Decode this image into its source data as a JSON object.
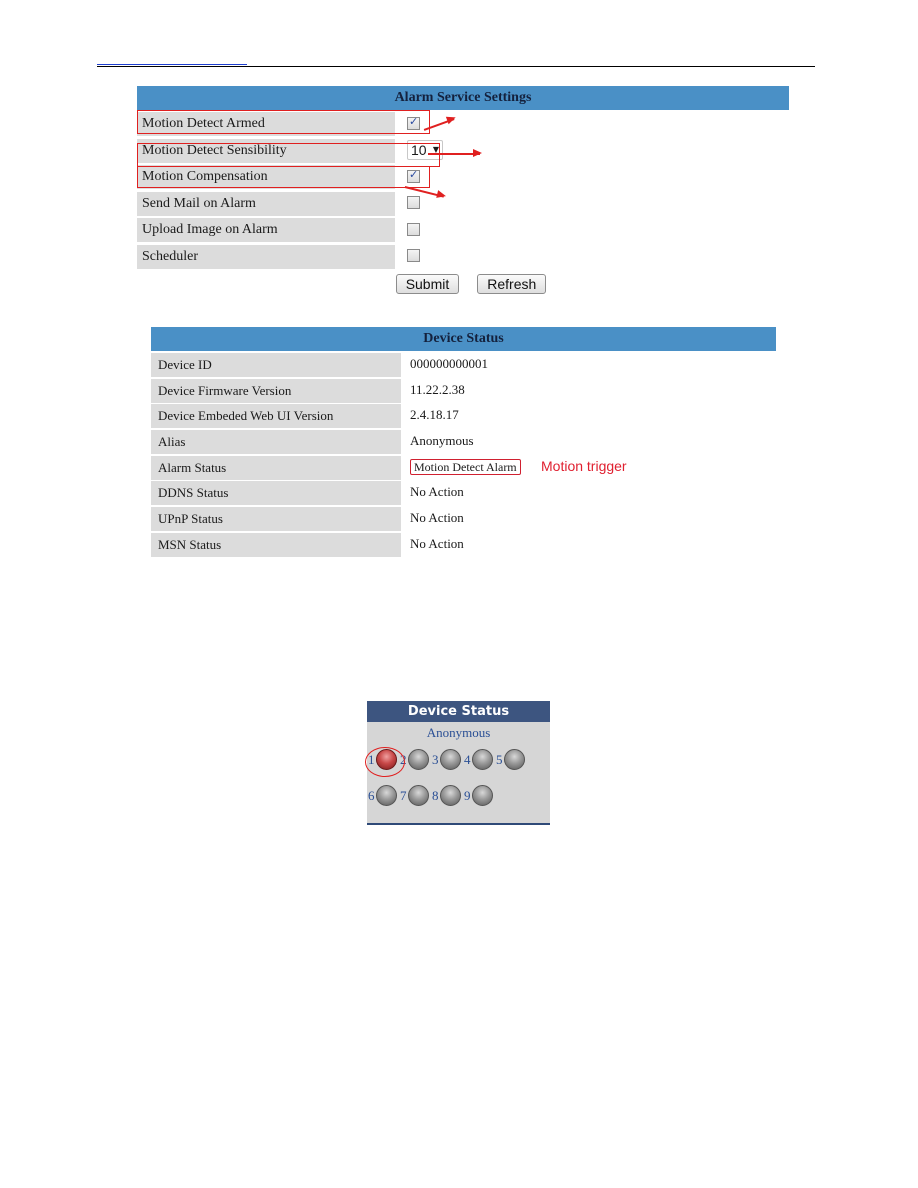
{
  "alarm_settings": {
    "title": "Alarm Service Settings",
    "rows": [
      {
        "label": "Motion Detect Armed",
        "type": "checkbox",
        "checked": true
      },
      {
        "label": "Motion Detect Sensibility",
        "type": "select",
        "value": "10"
      },
      {
        "label": "Motion Compensation",
        "type": "checkbox",
        "checked": true
      },
      {
        "label": "Send Mail on Alarm",
        "type": "checkbox",
        "checked": false
      },
      {
        "label": "Upload Image on Alarm",
        "type": "checkbox",
        "checked": false
      },
      {
        "label": "Scheduler",
        "type": "checkbox",
        "checked": false
      }
    ],
    "buttons": {
      "submit": "Submit",
      "refresh": "Refresh"
    }
  },
  "device_status": {
    "title": "Device Status",
    "rows": [
      {
        "label": "Device ID",
        "value": "000000000001"
      },
      {
        "label": "Device Firmware Version",
        "value": "11.22.2.38"
      },
      {
        "label": "Device Embeded Web UI Version",
        "value": "2.4.18.17"
      },
      {
        "label": "Alias",
        "value": "Anonymous"
      },
      {
        "label": "Alarm Status",
        "value": "Motion Detect Alarm"
      },
      {
        "label": "DDNS Status",
        "value": "No Action"
      },
      {
        "label": "UPnP Status",
        "value": "No Action"
      },
      {
        "label": "MSN Status",
        "value": "No Action"
      }
    ],
    "annotation": "Motion trigger"
  },
  "status_widget": {
    "title": "Device Status",
    "alias": "Anonymous",
    "channels": [
      {
        "num": "1",
        "active": true
      },
      {
        "num": "2",
        "active": false
      },
      {
        "num": "3",
        "active": false
      },
      {
        "num": "4",
        "active": false
      },
      {
        "num": "5",
        "active": false
      },
      {
        "num": "6",
        "active": false
      },
      {
        "num": "7",
        "active": false
      },
      {
        "num": "8",
        "active": false
      },
      {
        "num": "9",
        "active": false
      }
    ]
  },
  "colors": {
    "header_blue": "#4a90c6",
    "widget_header": "#3d5580",
    "annotation_red": "#e02020",
    "alarm_led": "#c84848"
  }
}
